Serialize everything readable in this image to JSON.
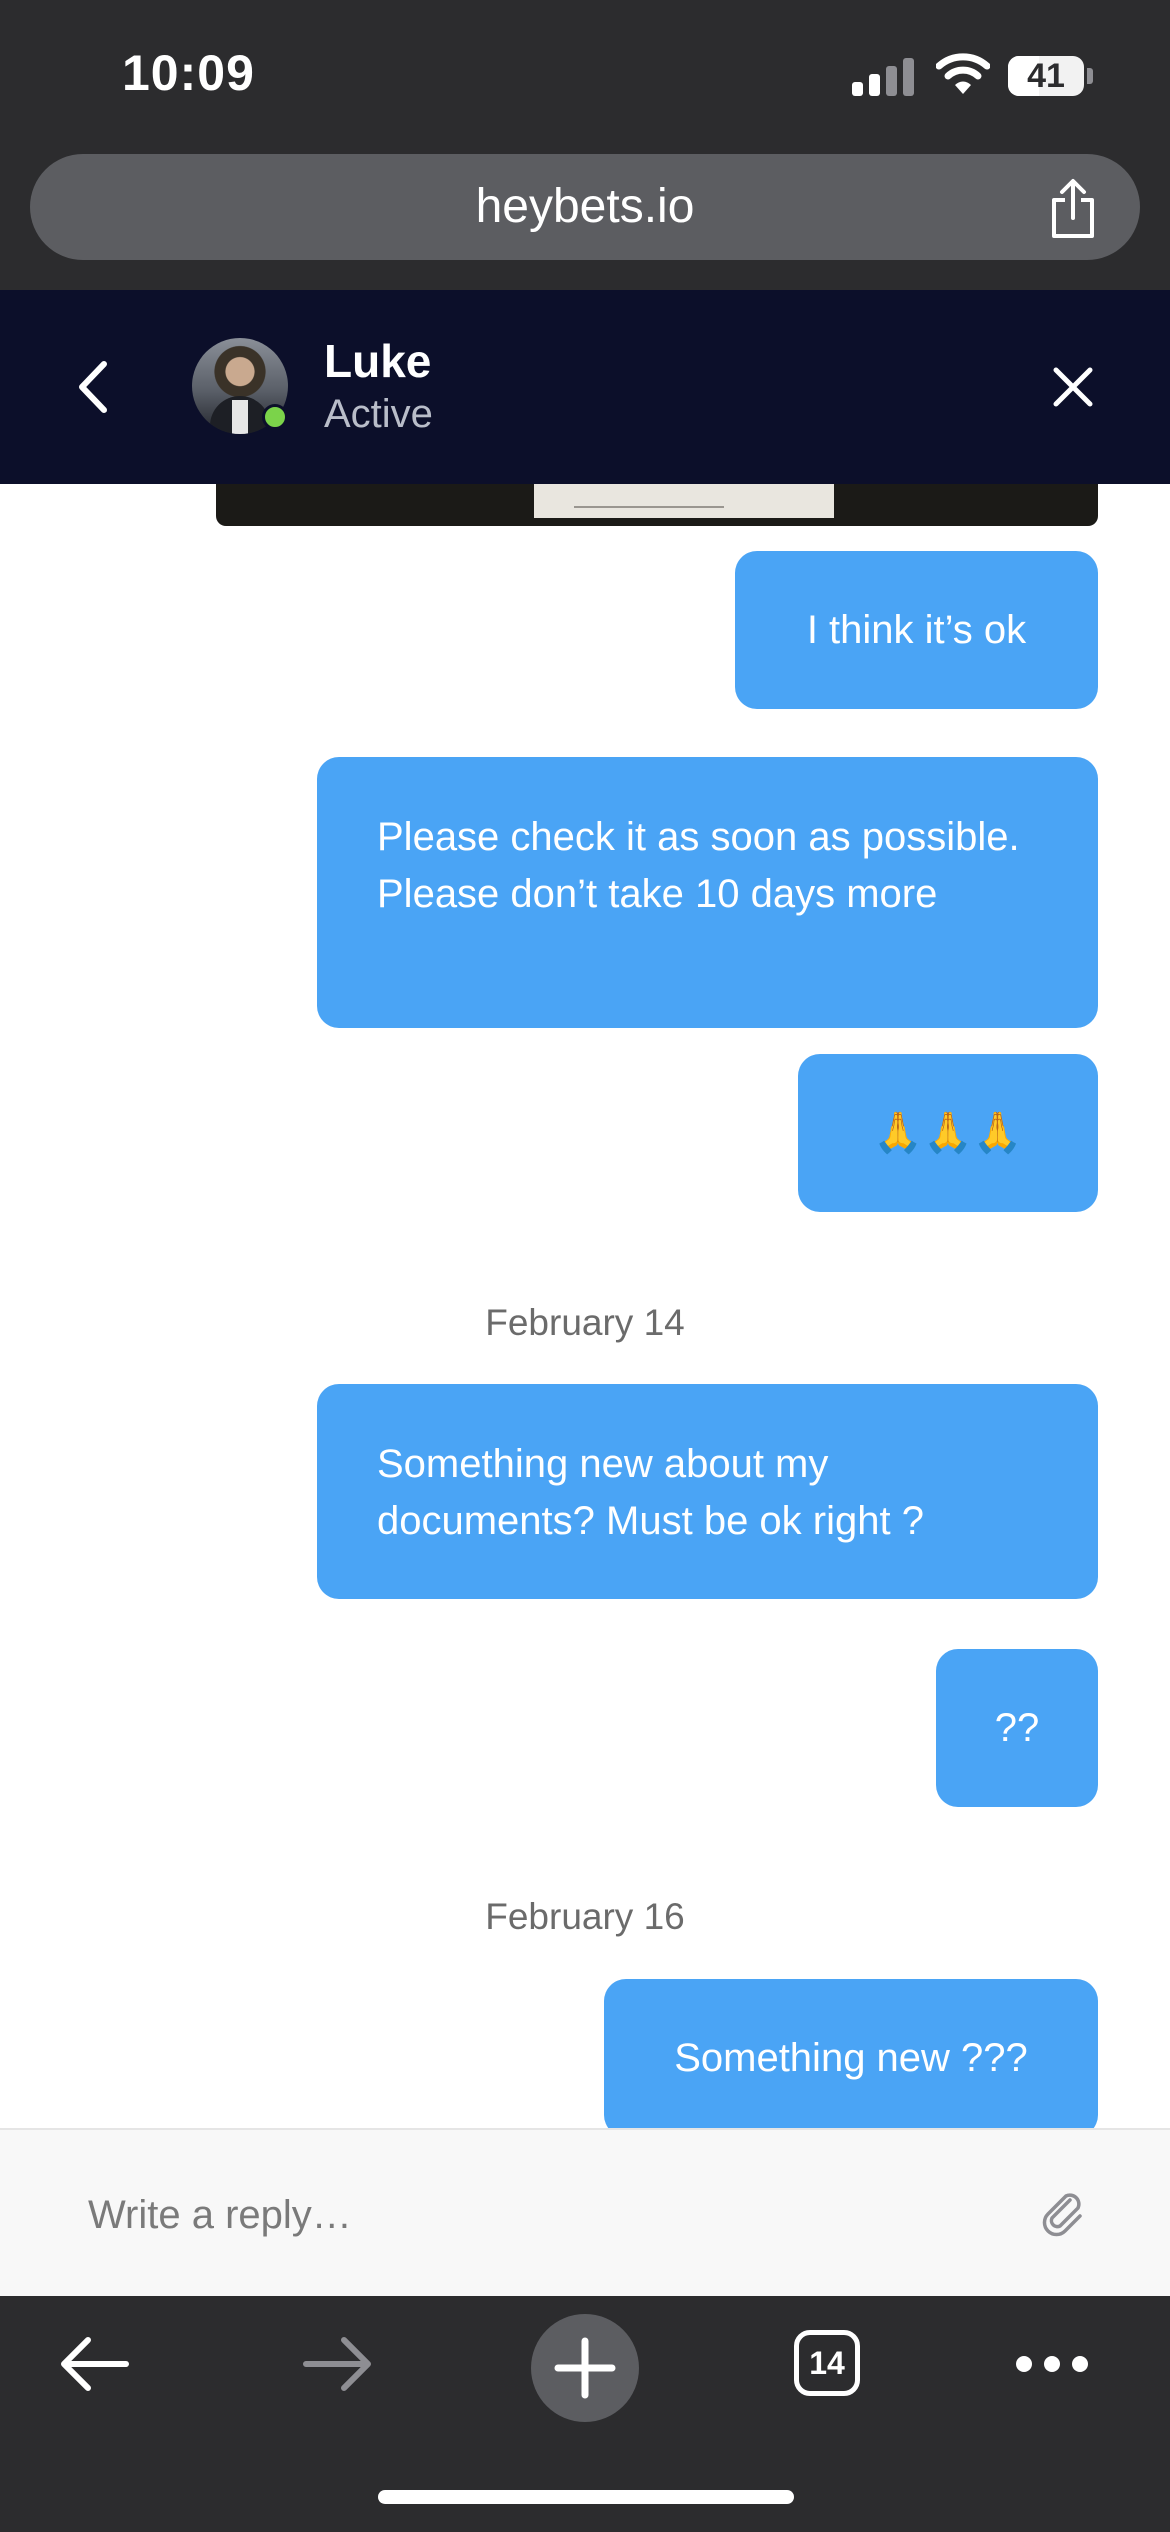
{
  "status_bar": {
    "time": "10:09",
    "battery_level": "41",
    "icons": [
      "signal-icon",
      "wifi-icon",
      "battery-icon"
    ]
  },
  "browser": {
    "url": "heybets.io",
    "tab_count": "14",
    "icons": [
      "share-icon",
      "back-arrow-icon",
      "forward-arrow-icon",
      "new-tab-icon",
      "tabs-icon",
      "more-icon"
    ]
  },
  "chat_header": {
    "contact_name": "Luke",
    "contact_status": "Active",
    "icons": [
      "back-chevron-icon",
      "close-icon"
    ]
  },
  "messages": [
    {
      "type": "outgoing",
      "text": "I think it’s ok"
    },
    {
      "type": "outgoing",
      "text": "Please check it as soon as possible. Please don’t take 10 days more"
    },
    {
      "type": "outgoing",
      "text": "🙏🙏🙏"
    },
    {
      "type": "date",
      "text": "February 14"
    },
    {
      "type": "outgoing",
      "text": "Something new about my documents? Must be ok right ?"
    },
    {
      "type": "outgoing",
      "text": "??"
    },
    {
      "type": "date",
      "text": "February 16"
    },
    {
      "type": "outgoing",
      "text": "Something new ???"
    }
  ],
  "reply": {
    "placeholder": "Write a reply…",
    "value": ""
  },
  "colors": {
    "bubble": "#4aa4f5",
    "header": "#0c0f2a",
    "browser_chrome": "#2c2c2e",
    "online": "#7bd34a"
  }
}
